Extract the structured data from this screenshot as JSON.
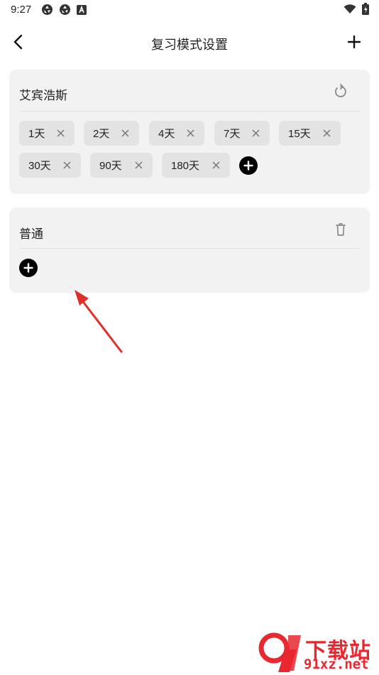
{
  "status_bar": {
    "time": "9:27"
  },
  "header": {
    "title": "复习模式设置",
    "back_icon": "chevron-left-icon",
    "add_icon": "plus-icon"
  },
  "cards": [
    {
      "title": "艾宾浩斯",
      "action_icon": "reset-icon",
      "chips": [
        "1天",
        "2天",
        "4天",
        "7天",
        "15天",
        "30天",
        "90天",
        "180天"
      ]
    },
    {
      "title": "普通",
      "action_icon": "trash-icon",
      "chips": []
    }
  ],
  "annotation": {
    "arrow_color": "#e0302a"
  },
  "watermark": {
    "top_text": "下载站",
    "bottom_text": "91xz.net",
    "color": "#e8272f"
  }
}
